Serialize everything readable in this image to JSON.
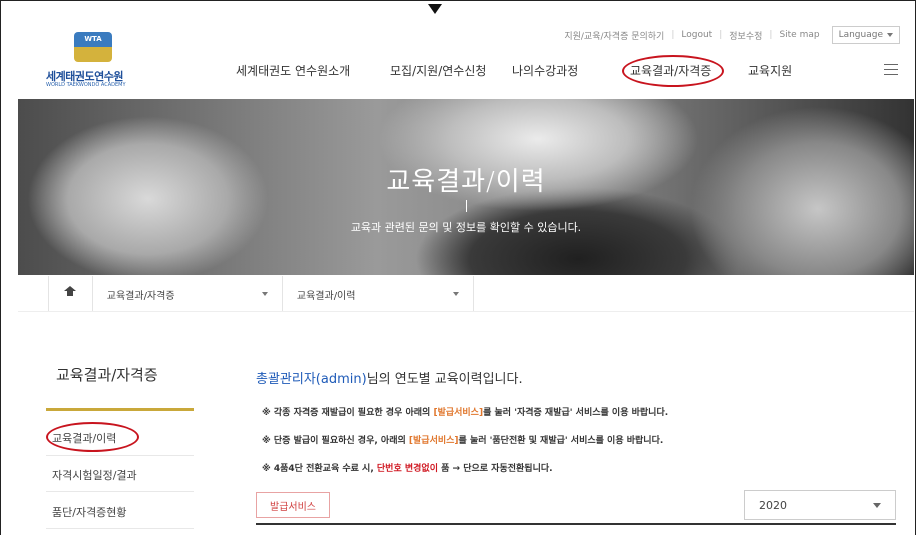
{
  "utility": {
    "inquiry": "지원/교육/자격증 문의하기",
    "logout": "Logout",
    "edit_info": "정보수정",
    "sitemap": "Site map",
    "language": "Language"
  },
  "logo": {
    "badge": "WTA",
    "name": "세계태권도연수원",
    "subtitle": "WORLD TAEKWONDO ACADEMY"
  },
  "nav": {
    "items": [
      "세계태권도 연수원소개",
      "모집/지원/연수신청",
      "나의수강과정",
      "교육결과/자격증",
      "교육지원"
    ]
  },
  "hero": {
    "title": "교육결과/이력",
    "subtitle": "교육과 관련된 문의 및 정보를 확인할 수 있습니다."
  },
  "breadcrumb": {
    "level1": "교육결과/자격증",
    "level2": "교육결과/이력"
  },
  "sidebar": {
    "title": "교육결과/자격증",
    "items": [
      "교육결과/이력",
      "자격시험일정/결과",
      "품단/자격증현황"
    ]
  },
  "main": {
    "greeting_name": "총괄관리자(admin)",
    "greeting_suffix": "님의 연도별 교육이력입니다.",
    "note1_a": "※ 각종 자격증 재발급이 필요한 경우 아래의 ",
    "note1_b": "[발급서비스]",
    "note1_c": "를 눌러 '자격증 재발급' 서비스를 이용 바랍니다.",
    "note2_a": "※ 단증 발급이 필요하신 경우, 아래의 ",
    "note2_b": "[발급서비스]",
    "note2_c": "를 눌러 '품단전환 및 재발급' 서비스를 이용 바랍니다.",
    "note3_a": "※ 4품4단 전환교육 수료 시, ",
    "note3_b": "단번호 변경없이",
    "note3_c": " 품 → 단으로 자동전환됩니다.",
    "issue_button": "발급서비스",
    "year": "2020"
  },
  "colors": {
    "brand_blue": "#1e4f9a",
    "accent_gold": "#c9a83a",
    "annotation_red": "#c8141e",
    "highlight_orange": "#e0762c"
  }
}
